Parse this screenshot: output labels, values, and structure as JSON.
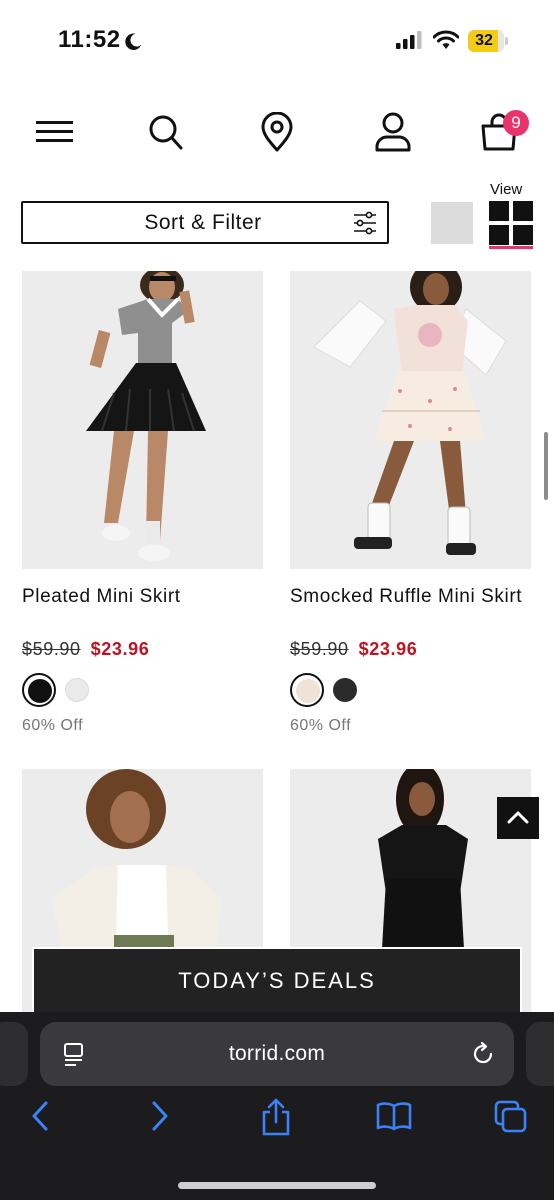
{
  "status_bar": {
    "time": "11:52",
    "battery_level": "32",
    "icons": [
      "moon-icon",
      "signal-icon",
      "wifi-icon",
      "battery-icon"
    ]
  },
  "header": {
    "icons": [
      "menu-icon",
      "search-icon",
      "location-icon",
      "account-icon",
      "bag-icon"
    ],
    "bag_count": "9"
  },
  "toolbar": {
    "sort_filter_label": "Sort & Filter",
    "view_label": "View",
    "view_options": [
      "single-view-icon",
      "grid-view-icon"
    ],
    "active_view": "grid"
  },
  "products": [
    {
      "name": "Pleated Mini Skirt",
      "original_price": "$59.90",
      "sale_price": "$23.96",
      "discount": "60% Off",
      "swatches": [
        {
          "color": "#111111",
          "selected": true
        },
        {
          "color": "#eaeaea",
          "selected": false
        }
      ]
    },
    {
      "name": "Smocked Ruffle Mini Skirt",
      "original_price": "$59.90",
      "sale_price": "$23.96",
      "discount": "60% Off",
      "swatches": [
        {
          "color": "#f1e2d6",
          "selected": true
        },
        {
          "color": "#2b2b2b",
          "selected": false
        }
      ]
    },
    {
      "name": "",
      "original_price": "",
      "sale_price": "",
      "discount": "",
      "swatches": []
    },
    {
      "name": "",
      "original_price": "",
      "sale_price": "",
      "discount": "",
      "swatches": []
    }
  ],
  "deals_banner": {
    "label": "TODAY’S DEALS"
  },
  "browser": {
    "url": "torrid.com",
    "toolbar_icons": [
      "back-icon",
      "forward-icon",
      "share-icon",
      "bookmarks-icon",
      "tabs-icon"
    ]
  },
  "colors": {
    "accent_pink": "#e8336d",
    "sale_red": "#c1121f",
    "browser_bg": "#1c1c1e",
    "browser_accent": "#3a82f7"
  }
}
